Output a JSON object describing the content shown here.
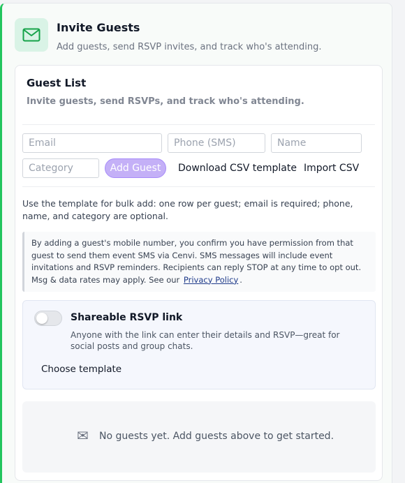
{
  "header": {
    "title": "Invite Guests",
    "subtitle": "Add guests, send RSVP invites, and track who's attending.",
    "icon": "mail-icon",
    "accent": "#22c55e"
  },
  "guest_list": {
    "title": "Guest List",
    "subtitle": "Invite guests, send RSVPs, and track who's attending."
  },
  "form": {
    "email_placeholder": "Email",
    "phone_placeholder": "Phone (SMS)",
    "name_placeholder": "Name",
    "category_placeholder": "Category",
    "add_button": "Add Guest",
    "download_template": "Download CSV template",
    "import_csv": "Import CSV"
  },
  "template_note": "Use the template for bulk add: one row per guest; email is required; phone, name, and category are optional.",
  "consent": {
    "text": "By adding a guest's mobile number, you confirm you have permission from that guest to send them event SMS via Cenvi. SMS messages will include event invitations and RSVP reminders. Recipients can reply STOP at any time to opt out. Msg & data rates may apply. See our",
    "privacy_link": "Privacy Policy",
    "suffix": "."
  },
  "shareable_rsvp": {
    "title": "Shareable RSVP link",
    "description": "Anyone with the link can enter their details and RSVP—great for social posts and group chats.",
    "toggle_on": false,
    "choose_template": "Choose template"
  },
  "empty_state": {
    "icon": "envelope-icon",
    "glyph": "✉",
    "text": "No guests yet. Add guests above to get started."
  }
}
